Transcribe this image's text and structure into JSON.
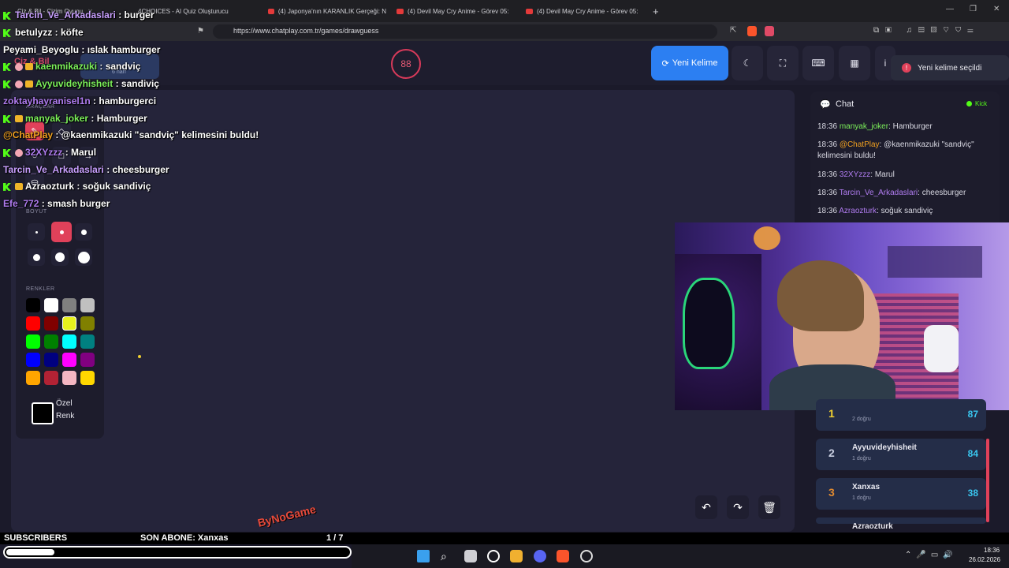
{
  "browser": {
    "tabs": [
      {
        "label": "Çiz & Bil - Çizim Oyunu"
      },
      {
        "label": "4CHOICES - AI Quiz Oluşturucu"
      },
      {
        "label": "(4) Japonya'nın KARANLIK Gerçeği: N"
      },
      {
        "label": "(4) Devil May Cry Anime - Görev 05:"
      },
      {
        "label": "(4) Devil May Cry Anime - Görev 05:"
      }
    ],
    "url": "https://www.chatplay.com.tr/games/drawguess"
  },
  "app": {
    "title": "Çiz & Bil",
    "word_hint": "6 harf",
    "timer": "88",
    "new_word_button": "Yeni Kelime",
    "toast": "Yeni kelime seçildi"
  },
  "tools": {
    "tools_label": "ARAÇLAR",
    "size_label": "BOYUT",
    "colors_label": "RENKLER",
    "custom_color_label_1": "Özel",
    "custom_color_label_2": "Renk",
    "colors": [
      "#000000",
      "#ffffff",
      "#808080",
      "#c0c0c0",
      "#ff0000",
      "#800000",
      "#e6f01e",
      "#808000",
      "#00ff00",
      "#008000",
      "#00ffff",
      "#008080",
      "#0000ff",
      "#000080",
      "#ff00ff",
      "#800080",
      "#ffa500",
      "#b22234",
      "#f4b6c2",
      "#ffd700"
    ]
  },
  "chat": {
    "title": "Chat",
    "platform": "Kick",
    "messages": [
      {
        "time": "18:36",
        "user": "manyak_joker",
        "text": ": Hamburger",
        "color": "#7cf05a"
      },
      {
        "time": "18:36",
        "user": "@ChatPlay",
        "text": ": @kaenmikazuki \"sandviç\"",
        "text2": "kelimesini buldu!",
        "color": "#f0a020"
      },
      {
        "time": "18:36",
        "user": "32XYzzz",
        "text": ": Marul",
        "color": "#b07cf0"
      },
      {
        "time": "18:36",
        "user": "Tarcin_Ve_Arkadaslari",
        "text": ": cheesburger",
        "color": "#b07cf0"
      },
      {
        "time": "18:36",
        "user": "Azraozturk",
        "text": ": soğuk sandiviç",
        "color": "#b07cf0"
      }
    ]
  },
  "scoreboard": [
    {
      "rank": "1",
      "name": "",
      "correct": "2 doğru",
      "points": "87",
      "color": "#f0d030"
    },
    {
      "rank": "2",
      "name": "Ayyuvideyhisheit",
      "correct": "1 doğru",
      "points": "84",
      "color": "#c8cee0"
    },
    {
      "rank": "3",
      "name": "Xanxas",
      "correct": "1 doğru",
      "points": "38",
      "color": "#e08a30"
    },
    {
      "rank": "",
      "name": "Azraozturk",
      "correct": "",
      "points": "",
      "color": "#c8cee0"
    }
  ],
  "overlay_chat": [
    {
      "user": "Tarcin_Ve_Arkadaslari",
      "text": " : burger",
      "color": "#c9a0ff",
      "badges": [
        "kick"
      ]
    },
    {
      "user": "betulyzz",
      "text": " : köfte",
      "color": "#ffffff",
      "badges": [
        "kick"
      ]
    },
    {
      "user": "Peyami_Beyoglu",
      "text": " : ıslak hamburger",
      "color": "#ffffff",
      "badges": []
    },
    {
      "user": "kaenmikazuki",
      "text": " : sandviç",
      "color": "#7cf05a",
      "badges": [
        "kick",
        "bubble",
        "crown"
      ]
    },
    {
      "user": "Ayyuvideyhisheit",
      "text": " : sandiviç",
      "color": "#7cf05a",
      "badges": [
        "kick",
        "bubble",
        "crown"
      ]
    },
    {
      "user": "zoktayhayranisel1n",
      "text": " : hamburgerci",
      "color": "#b07cf0",
      "badges": []
    },
    {
      "user": "manyak_joker",
      "text": " : Hamburger",
      "color": "#7cf05a",
      "badges": [
        "kick",
        "crown"
      ]
    },
    {
      "user": "@ChatPlay",
      "text": " : @kaenmikazuki \"sandviç\" kelimesini buldu!",
      "color": "#f0a020",
      "badges": []
    },
    {
      "user": "32XYzzz",
      "text": " : Marul",
      "color": "#b07cf0",
      "badges": [
        "kick",
        "bubble"
      ]
    },
    {
      "user": "Tarcin_Ve_Arkadaslari",
      "text": " : cheesburger",
      "color": "#c9a0ff",
      "badges": []
    },
    {
      "user": "Azraozturk",
      "text": " : soğuk sandiviç",
      "color": "#ffffff",
      "badges": [
        "kick",
        "crown"
      ]
    },
    {
      "user": "Efe_772",
      "text": " : smash burger",
      "color": "#b07cf0",
      "badges": []
    }
  ],
  "stream": {
    "subscribers_label": "SUBSCRIBERS",
    "last_sub": "SON ABONE: Xanxas",
    "page": "1 / 7",
    "logo": "ByNoGame",
    "progress": 0.14
  },
  "taskbar": {
    "time": "18:36",
    "date": "26.02.2026"
  }
}
